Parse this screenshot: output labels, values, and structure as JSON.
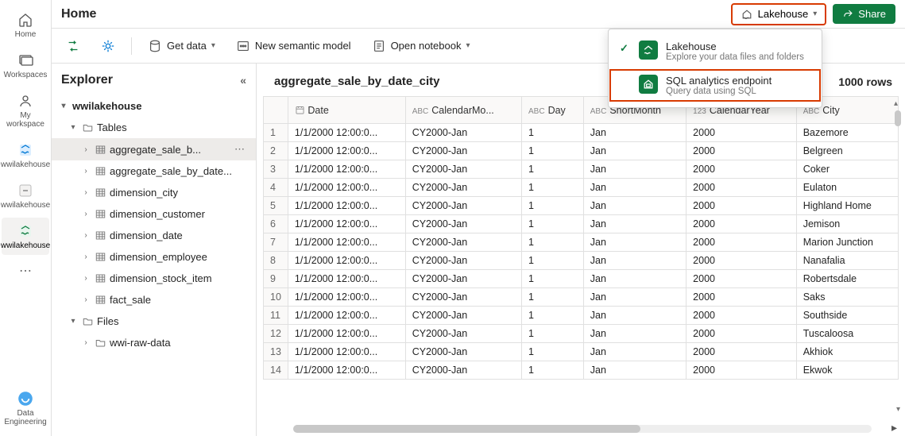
{
  "leftrail": {
    "items": [
      {
        "label": "Home"
      },
      {
        "label": "Workspaces"
      },
      {
        "label": "My workspace"
      },
      {
        "label": "wwilakehouse"
      },
      {
        "label": "wwilakehouse"
      },
      {
        "label": "wwilakehouse"
      }
    ],
    "bottom_label": "Data Engineering"
  },
  "breadcrumb": "Home",
  "mode_button": "Lakehouse",
  "share_button": "Share",
  "toolbar": {
    "get_data": "Get data",
    "new_semantic": "New semantic model",
    "open_notebook": "Open notebook"
  },
  "explorer": {
    "title": "Explorer",
    "root": "wwilakehouse",
    "tables_label": "Tables",
    "files_label": "Files",
    "tables": [
      "aggregate_sale_b...",
      "aggregate_sale_by_date...",
      "dimension_city",
      "dimension_customer",
      "dimension_date",
      "dimension_employee",
      "dimension_stock_item",
      "fact_sale"
    ],
    "files": [
      "wwi-raw-data"
    ]
  },
  "content": {
    "table_name": "aggregate_sale_by_date_city",
    "row_count": "1000 rows",
    "columns": [
      {
        "type": "date",
        "label": "Date"
      },
      {
        "type": "abc",
        "label": "CalendarMo..."
      },
      {
        "type": "abc",
        "label": "Day"
      },
      {
        "type": "abc",
        "label": "ShortMonth"
      },
      {
        "type": "123",
        "label": "CalendarYear"
      },
      {
        "type": "abc",
        "label": "City"
      }
    ],
    "rows": [
      [
        "1/1/2000 12:00:0...",
        "CY2000-Jan",
        "1",
        "Jan",
        "2000",
        "Bazemore"
      ],
      [
        "1/1/2000 12:00:0...",
        "CY2000-Jan",
        "1",
        "Jan",
        "2000",
        "Belgreen"
      ],
      [
        "1/1/2000 12:00:0...",
        "CY2000-Jan",
        "1",
        "Jan",
        "2000",
        "Coker"
      ],
      [
        "1/1/2000 12:00:0...",
        "CY2000-Jan",
        "1",
        "Jan",
        "2000",
        "Eulaton"
      ],
      [
        "1/1/2000 12:00:0...",
        "CY2000-Jan",
        "1",
        "Jan",
        "2000",
        "Highland Home"
      ],
      [
        "1/1/2000 12:00:0...",
        "CY2000-Jan",
        "1",
        "Jan",
        "2000",
        "Jemison"
      ],
      [
        "1/1/2000 12:00:0...",
        "CY2000-Jan",
        "1",
        "Jan",
        "2000",
        "Marion Junction"
      ],
      [
        "1/1/2000 12:00:0...",
        "CY2000-Jan",
        "1",
        "Jan",
        "2000",
        "Nanafalia"
      ],
      [
        "1/1/2000 12:00:0...",
        "CY2000-Jan",
        "1",
        "Jan",
        "2000",
        "Robertsdale"
      ],
      [
        "1/1/2000 12:00:0...",
        "CY2000-Jan",
        "1",
        "Jan",
        "2000",
        "Saks"
      ],
      [
        "1/1/2000 12:00:0...",
        "CY2000-Jan",
        "1",
        "Jan",
        "2000",
        "Southside"
      ],
      [
        "1/1/2000 12:00:0...",
        "CY2000-Jan",
        "1",
        "Jan",
        "2000",
        "Tuscaloosa"
      ],
      [
        "1/1/2000 12:00:0...",
        "CY2000-Jan",
        "1",
        "Jan",
        "2000",
        "Akhiok"
      ],
      [
        "1/1/2000 12:00:0...",
        "CY2000-Jan",
        "1",
        "Jan",
        "2000",
        "Ekwok"
      ]
    ]
  },
  "dropdown": {
    "items": [
      {
        "title": "Lakehouse",
        "sub": "Explore your data files and folders",
        "check": true
      },
      {
        "title": "SQL analytics endpoint",
        "sub": "Query data using SQL",
        "check": false
      }
    ]
  }
}
